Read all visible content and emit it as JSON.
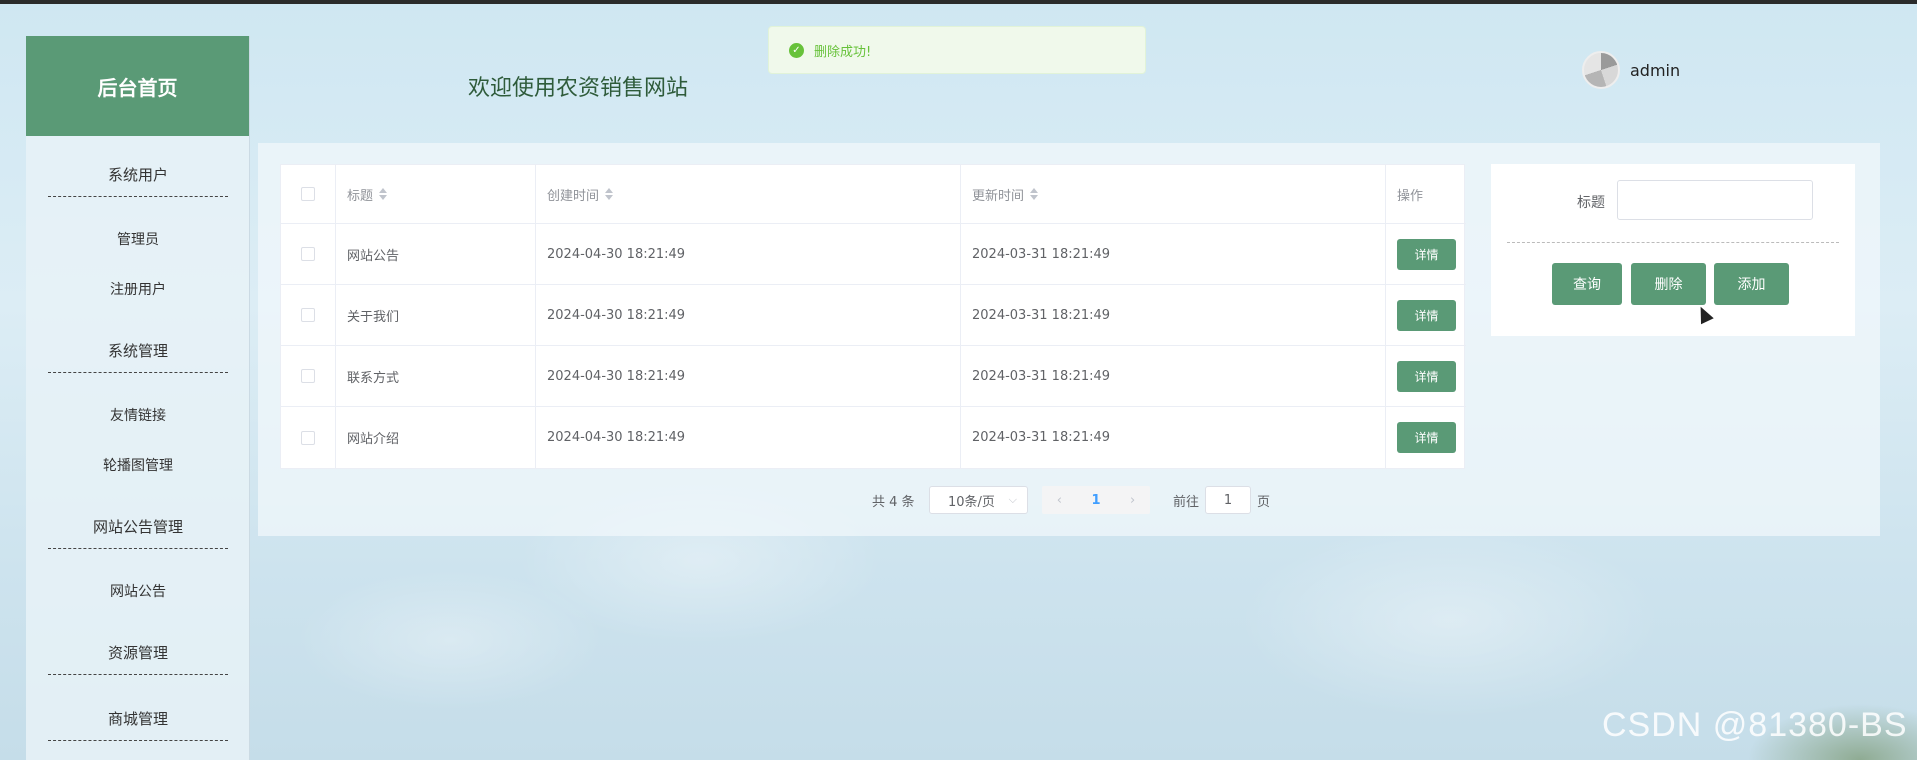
{
  "sidebar": {
    "brand": "后台首页",
    "menu": {
      "g1": "系统用户",
      "admin": "管理员",
      "users": "注册用户",
      "g2": "系统管理",
      "links": "友情链接",
      "carousel": "轮播图管理",
      "g3": "网站公告管理",
      "notice": "网站公告",
      "g4": "资源管理",
      "g5": "商城管理"
    }
  },
  "header": {
    "welcome": "欢迎使用农资销售网站",
    "username": "admin"
  },
  "toast": {
    "message": "删除成功!"
  },
  "table": {
    "columns": [
      "标题",
      "创建时间",
      "更新时间",
      "操作"
    ],
    "rows": [
      {
        "title": "网站公告",
        "created": "2024-04-30 18:21:49",
        "updated": "2024-03-31 18:21:49"
      },
      {
        "title": "关于我们",
        "created": "2024-04-30 18:21:49",
        "updated": "2024-03-31 18:21:49"
      },
      {
        "title": "联系方式",
        "created": "2024-04-30 18:21:49",
        "updated": "2024-03-31 18:21:49"
      },
      {
        "title": "网站介绍",
        "created": "2024-04-30 18:21:49",
        "updated": "2024-03-31 18:21:49"
      }
    ],
    "detail_label": "详情"
  },
  "pagination": {
    "total": "共 4 条",
    "page_size": "10条/页",
    "current": "1",
    "goto_prefix": "前往",
    "goto_value": "1",
    "goto_suffix": "页"
  },
  "search": {
    "title_label": "标题",
    "query_label": "查询",
    "delete_label": "删除",
    "add_label": "添加"
  },
  "watermark": "CSDN @81380-BS",
  "colors": {
    "brand": "#5a9a76",
    "success": "#67c23a",
    "link": "#409eff"
  }
}
